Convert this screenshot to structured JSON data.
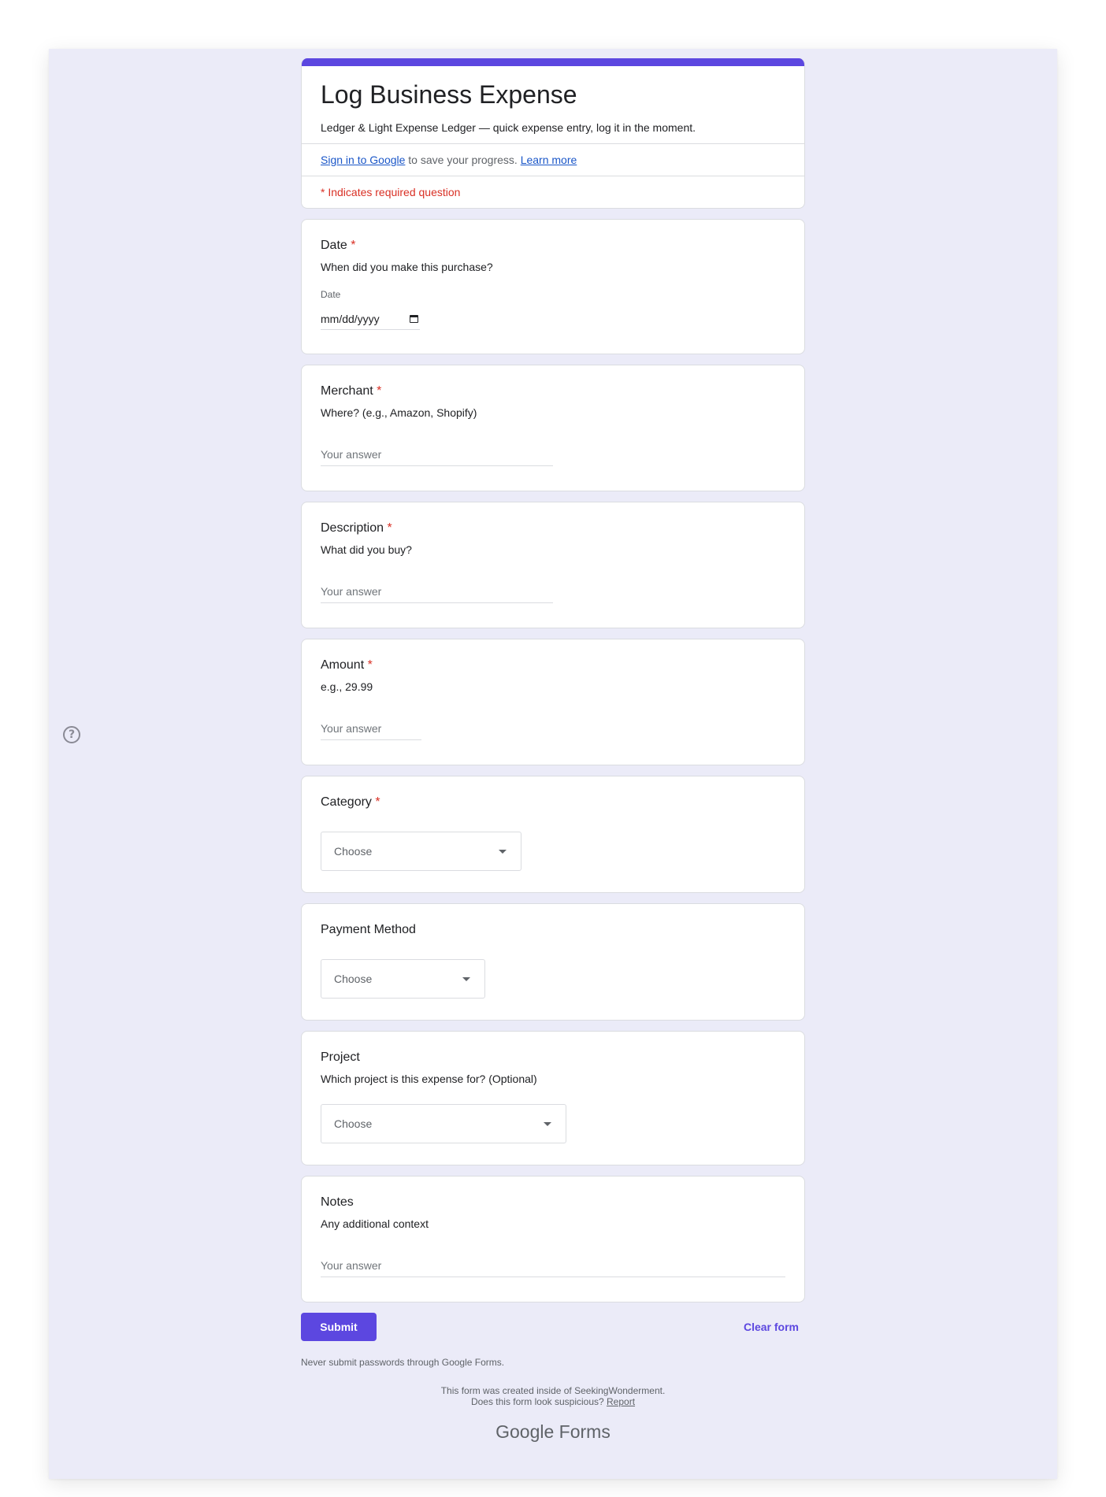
{
  "form": {
    "title": "Log Business Expense",
    "description": "Ledger & Light Expense Ledger — quick expense entry, log it in the moment.",
    "signin_link": "Sign in to Google",
    "signin_text": " to save your progress. ",
    "learn_more": "Learn more",
    "required_note": "* Indicates required question"
  },
  "questions": {
    "date": {
      "title": "Date",
      "required": "*",
      "help": "When did you make this purchase?",
      "sub_label": "Date",
      "placeholder": "mm/dd/yyyy"
    },
    "merchant": {
      "title": "Merchant",
      "required": "*",
      "help": "Where? (e.g., Amazon, Shopify)",
      "placeholder": "Your answer"
    },
    "description": {
      "title": "Description",
      "required": "*",
      "help": "What did you buy?",
      "placeholder": "Your answer"
    },
    "amount": {
      "title": "Amount",
      "required": "*",
      "help": "e.g., 29.99",
      "placeholder": "Your answer"
    },
    "category": {
      "title": "Category",
      "required": "*",
      "selected": "Choose"
    },
    "payment_method": {
      "title": "Payment Method",
      "selected": "Choose"
    },
    "project": {
      "title": "Project",
      "help": "Which project is this expense for? (Optional)",
      "selected": "Choose"
    },
    "notes": {
      "title": "Notes",
      "help": "Any additional context",
      "placeholder": "Your answer"
    }
  },
  "actions": {
    "submit": "Submit",
    "clear": "Clear form"
  },
  "footer": {
    "never_note": "Never submit passwords through Google Forms.",
    "created_line": "This form was created inside of SeekingWonderment.",
    "suspicious_text": "Does this form look suspicious? ",
    "report": "Report",
    "brand_google": "Google",
    "brand_forms": " Forms"
  },
  "colors": {
    "accent": "#5c47e0",
    "background": "#ebebf8",
    "required": "#d93025",
    "link": "#1a56c8"
  },
  "icons": {
    "help": "help-circle-icon",
    "calendar": "calendar-icon",
    "dropdown": "chevron-down-icon"
  }
}
